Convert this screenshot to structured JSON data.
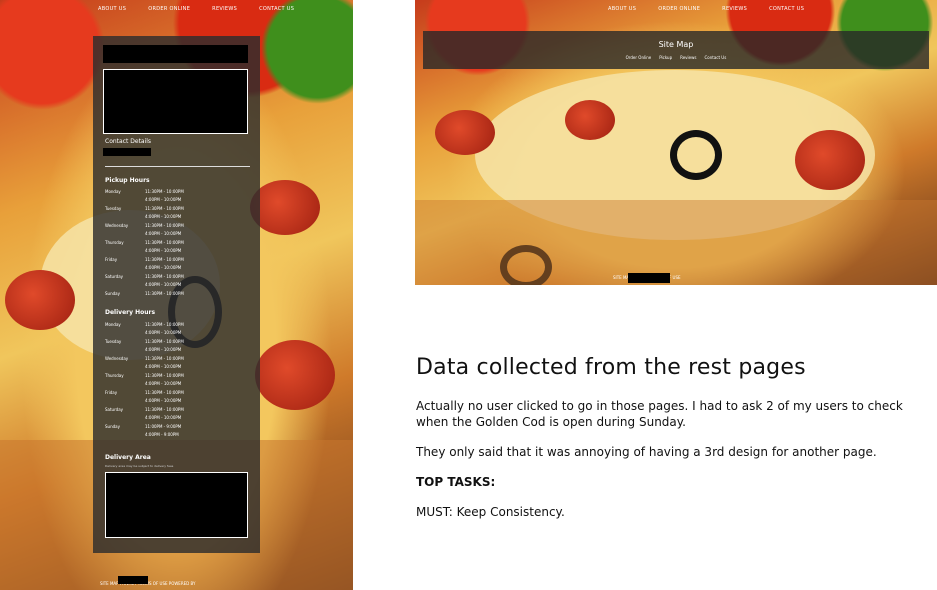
{
  "left_page": {
    "nav": [
      "ABOUT US",
      "ORDER ONLINE",
      "REVIEWS",
      "CONTACT US"
    ],
    "contact_title": "Contact Details",
    "pickup_title": "Pickup Hours",
    "pickup": [
      {
        "day": "Monday",
        "t1": "11:30PM - 10:00PM",
        "t2": "4:00PM - 10:00PM"
      },
      {
        "day": "Tuesday",
        "t1": "11:30PM - 10:00PM",
        "t2": "4:00PM - 10:00PM"
      },
      {
        "day": "Wednesday",
        "t1": "11:30PM - 10:00PM",
        "t2": "4:00PM - 10:00PM"
      },
      {
        "day": "Thursday",
        "t1": "11:30PM - 10:00PM",
        "t2": "4:00PM - 10:00PM"
      },
      {
        "day": "Friday",
        "t1": "11:30PM - 10:00PM",
        "t2": "4:00PM - 10:00PM"
      },
      {
        "day": "Saturday",
        "t1": "11:30PM - 10:00PM",
        "t2": "4:00PM - 10:00PM"
      },
      {
        "day": "Sunday",
        "t1": "11:30PM - 10:00PM",
        "t2": ""
      }
    ],
    "delivery_title": "Delivery Hours",
    "delivery": [
      {
        "day": "Monday",
        "t1": "11:30PM - 10:00PM",
        "t2": "4:00PM - 10:00PM"
      },
      {
        "day": "Tuesday",
        "t1": "11:30PM - 10:00PM",
        "t2": "4:00PM - 10:00PM"
      },
      {
        "day": "Wednesday",
        "t1": "11:30PM - 10:00PM",
        "t2": "4:00PM - 10:00PM"
      },
      {
        "day": "Thursday",
        "t1": "11:30PM - 10:00PM",
        "t2": "4:00PM - 10:00PM"
      },
      {
        "day": "Friday",
        "t1": "11:30PM - 10:00PM",
        "t2": "4:00PM - 10:00PM"
      },
      {
        "day": "Saturday",
        "t1": "11:30PM - 10:00PM",
        "t2": "4:00PM - 10:00PM"
      },
      {
        "day": "Sunday",
        "t1": "11:00PM - 9:00PM",
        "t2": "4:00PM - 9:00PM"
      }
    ],
    "delivery_area_title": "Delivery Area",
    "delivery_area_note": "Delivery area may be subject to delivery fees",
    "footer": "SITE MAP   PRIVACY   TERMS OF USE   POWERED BY"
  },
  "right_page": {
    "nav": [
      "ABOUT US",
      "ORDER ONLINE",
      "REVIEWS",
      "CONTACT US"
    ],
    "sitemap_title": "Site Map",
    "sitemap_links": [
      "Order Online",
      "Pickup",
      "Reviews",
      "Contact Us"
    ],
    "photo_footer": "SITE MAP   PRIVACY   TERMS OF USE"
  },
  "article": {
    "heading": "Data collected from the rest pages",
    "p1": "Actually no user clicked to go in those pages. I had to ask 2 of my users to check when the Golden Cod is open during Sunday.",
    "p2": "They only said that it was annoying of having a 3rd design for another page.",
    "top_tasks": "TOP TASKS:",
    "must": "MUST: Keep Consistency."
  }
}
